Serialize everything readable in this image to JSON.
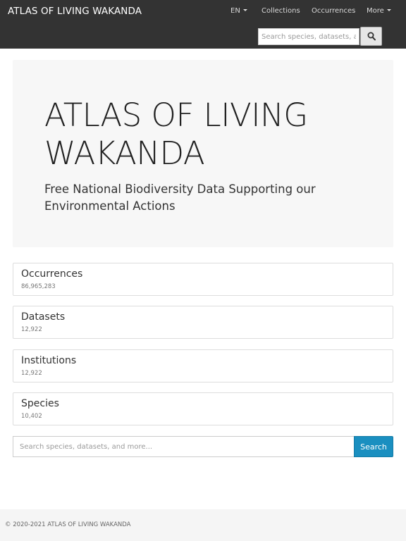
{
  "navbar": {
    "brand": "ATLAS OF LIVING WAKANDA",
    "language": "EN",
    "links": [
      "Collections",
      "Occurrences"
    ],
    "more": "More",
    "search_placeholder": "Search species, datasets, and more...",
    "search_icon": "magnifier-icon"
  },
  "hero": {
    "title": "ATLAS OF LIVING WAKANDA",
    "subtitle": "Free National Biodiversity Data Supporting our Environmental Actions"
  },
  "stats": [
    {
      "label": "Occurrences",
      "count": "86,965,283"
    },
    {
      "label": "Datasets",
      "count": "12,922"
    },
    {
      "label": "Institutions",
      "count": "12,922"
    },
    {
      "label": "Species",
      "count": "10,402"
    }
  ],
  "search": {
    "placeholder": "Search species, datasets, and more...",
    "button": "Search"
  },
  "footer": {
    "copyright": "© 2020-2021 ATLAS OF LIVING WAKANDA"
  },
  "colors": {
    "navbar_bg": "#333333",
    "hero_bg": "#f7f7f7",
    "primary": "#1a8fc0",
    "footer_bg": "#f5f5f5"
  }
}
